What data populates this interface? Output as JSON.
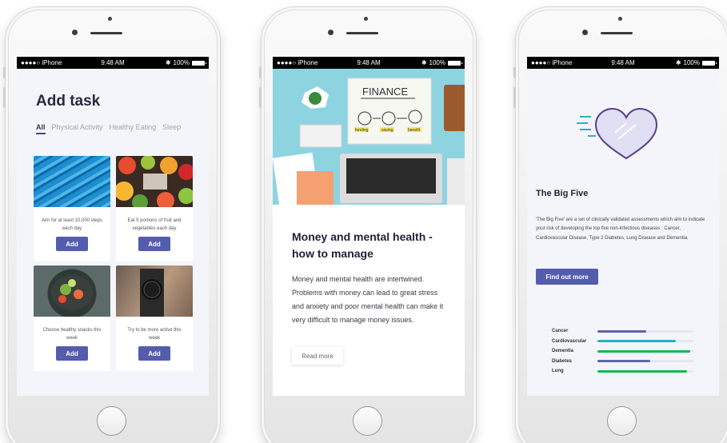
{
  "status_bar": {
    "carrier": "●●●●○ iPhone ",
    "time": "9:48 AM",
    "battery": "100%"
  },
  "colors": {
    "primary_button": "#545cae",
    "teal": "#1fb5c1",
    "green": "#10b950",
    "purple": "#5f62ad"
  },
  "screen1": {
    "title": "Add task",
    "tabs": [
      "All",
      "Physical Activity",
      "Healthy Eating",
      "Sleep"
    ],
    "active_tab": "All",
    "cards": [
      {
        "image": "escalator-photo",
        "text": "Aim for at least 10,000 steps each day",
        "button": "Add"
      },
      {
        "image": "fruit-photo",
        "text": "Eat 5 portions of fruit and vegetables each day",
        "button": "Add"
      },
      {
        "image": "salad-photo",
        "text": "Choose healthy snacks this week",
        "button": "Add"
      },
      {
        "image": "smartwatch-photo",
        "text": "Try to be more active this week",
        "button": "Add"
      }
    ]
  },
  "screen2": {
    "hero": {
      "board_title": "FINANCE",
      "labels": [
        "funding",
        "saving",
        "benefit"
      ]
    },
    "title": "Money and mental health - how to manage",
    "body": "Money and mental health are intertwined. Problems with money can lead to great stress and anxiety and poor mental health can make it very difficult to manage money issues.",
    "button": "Read more"
  },
  "screen3": {
    "icon": "heart-icon",
    "title": "The Big Five",
    "body": "'The Big Five' are a set of clinically validated assessments which aim to indicate your risk of developing the top five non-infectious diseases : Cancer, Cardiovascular Disease, Type 2 Diabetes, Lung Disease and Dementia.",
    "button": "Find out more",
    "risks": [
      {
        "label": "Cancer",
        "level": 0.51,
        "color": "#5f62ad"
      },
      {
        "label": "Cardiovascular",
        "level": 0.82,
        "color": "#1fb5c1"
      },
      {
        "label": "Dementia",
        "level": 0.97,
        "color": "#10b950"
      },
      {
        "label": "Diabetes",
        "level": 0.55,
        "color": "#5f62ad"
      },
      {
        "label": "Lung",
        "level": 0.93,
        "color": "#10b950"
      }
    ]
  }
}
